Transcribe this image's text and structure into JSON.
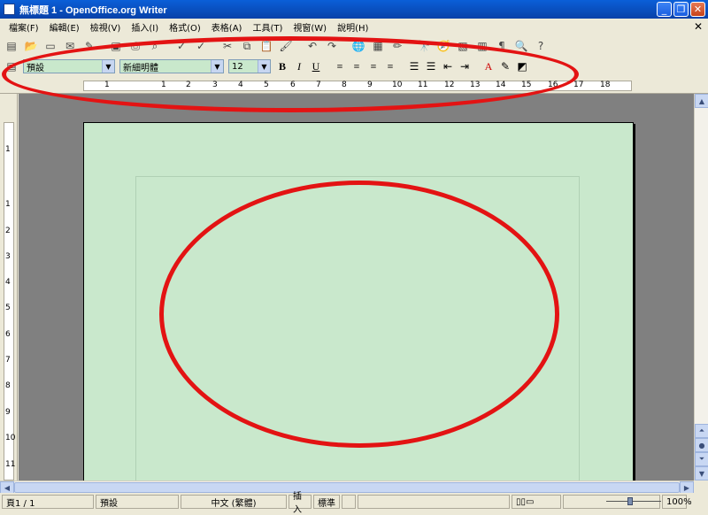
{
  "window": {
    "title": "無標題 1 - OpenOffice.org Writer",
    "minimize": "_",
    "restore": "❐",
    "close": "✕"
  },
  "menu": {
    "items": [
      "檔案(F)",
      "編輯(E)",
      "檢視(V)",
      "插入(I)",
      "格式(O)",
      "表格(A)",
      "工具(T)",
      "視窗(W)",
      "說明(H)"
    ],
    "close_document": "✕"
  },
  "standard_toolbar": {
    "icons": [
      "new-icon",
      "open-icon",
      "save-icon",
      "email-icon",
      "edit-file-icon",
      "export-pdf-icon",
      "print-icon",
      "print-preview-icon",
      "spellcheck-icon",
      "autospellcheck-icon",
      "cut-icon",
      "copy-icon",
      "paste-icon",
      "format-paintbrush-icon",
      "undo-icon",
      "redo-icon",
      "hyperlink-icon",
      "table-icon",
      "draw-functions-icon",
      "find-replace-icon",
      "navigator-icon",
      "gallery-icon",
      "data-sources-icon",
      "formatting-marks-icon",
      "zoom-icon",
      "help-icon"
    ]
  },
  "formatting_toolbar": {
    "style": "預設",
    "font": "新細明體",
    "size": "12",
    "bold": "B",
    "italic": "I",
    "underline": "U"
  },
  "ruler": {
    "h_numbers": [
      "1",
      "1",
      "2",
      "3",
      "4",
      "5",
      "6",
      "7",
      "8",
      "9",
      "10",
      "11",
      "12",
      "13",
      "14",
      "15",
      "16",
      "17",
      "18"
    ],
    "v_numbers": [
      "1",
      "1",
      "2",
      "3",
      "4",
      "5",
      "6",
      "7",
      "8",
      "9",
      "10",
      "11"
    ]
  },
  "statusbar": {
    "page": "頁1 / 1",
    "page_style": "預設",
    "language": "中文 (繁體)",
    "insert_mode": "插入",
    "selection_mode": "標準",
    "zoom": "100%"
  },
  "colors": {
    "annotation": "#e31313",
    "page_background": "#c9e8cc"
  }
}
